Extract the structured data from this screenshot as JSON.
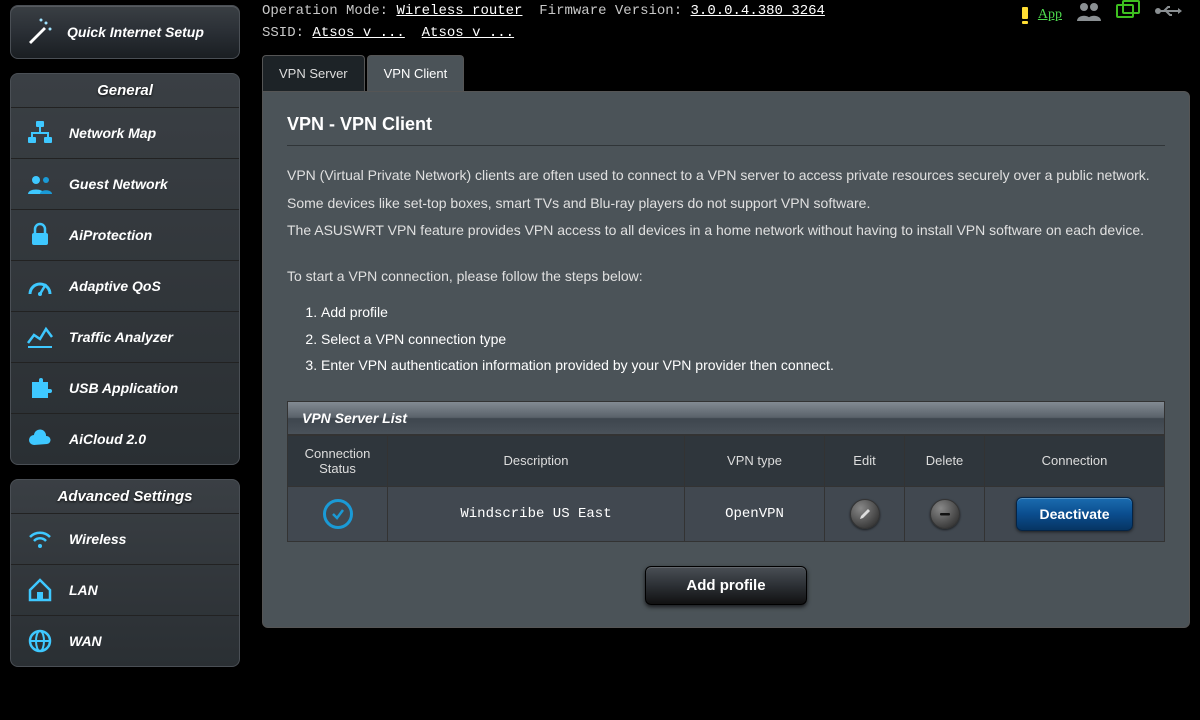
{
  "quick_setup": {
    "label": "Quick Internet Setup"
  },
  "sidebar": {
    "general_header": "General",
    "general_items": [
      {
        "label": "Network Map"
      },
      {
        "label": "Guest Network"
      },
      {
        "label": "AiProtection"
      },
      {
        "label": "Adaptive QoS"
      },
      {
        "label": "Traffic Analyzer"
      },
      {
        "label": "USB Application"
      },
      {
        "label": "AiCloud 2.0"
      }
    ],
    "advanced_header": "Advanced Settings",
    "advanced_items": [
      {
        "label": "Wireless"
      },
      {
        "label": "LAN"
      },
      {
        "label": "WAN"
      }
    ]
  },
  "header": {
    "op_mode_label": "Operation Mode:",
    "op_mode_value": "Wireless router",
    "firmware_label": "Firmware Version:",
    "firmware_value": "3.0.0.4.380_3264",
    "ssid_label": "SSID:",
    "ssid_1": "Atsos v ...",
    "ssid_2": "Atsos v ...",
    "app_label": "App"
  },
  "tabs": [
    {
      "label": "VPN Server",
      "active": false
    },
    {
      "label": "VPN Client",
      "active": true
    }
  ],
  "page": {
    "title": "VPN - VPN Client",
    "desc_p1": "VPN (Virtual Private Network) clients are often used to connect to a VPN server to access private resources securely over a public network.",
    "desc_p2": "Some devices like set-top boxes, smart TVs and Blu-ray players do not support VPN software.",
    "desc_p3": "The ASUSWRT VPN feature provides VPN access to all devices in a home network without having to install VPN software on each device.",
    "steps_intro": "To start a VPN connection, please follow the steps below:",
    "steps": [
      "Add profile",
      "Select a VPN connection type",
      "Enter VPN authentication information provided by your VPN provider then connect."
    ]
  },
  "server_list": {
    "title": "VPN Server List",
    "columns": {
      "status": "Connection Status",
      "description": "Description",
      "vpn_type": "VPN type",
      "edit": "Edit",
      "delete": "Delete",
      "connection": "Connection"
    },
    "rows": [
      {
        "description": "Windscribe US East",
        "vpn_type": "OpenVPN",
        "connection_button": "Deactivate"
      }
    ]
  },
  "add_profile_label": "Add profile"
}
